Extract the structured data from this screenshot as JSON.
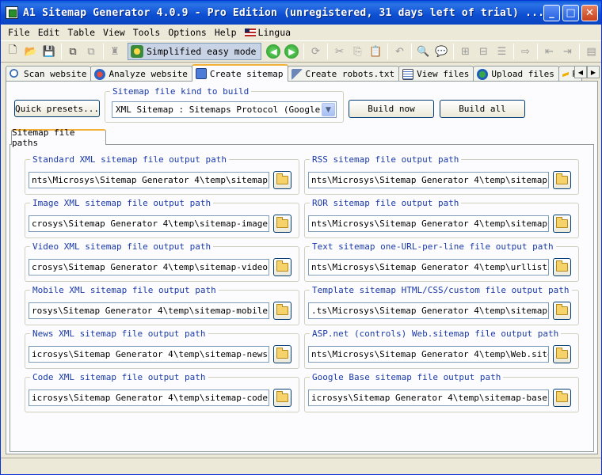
{
  "window": {
    "title": "A1 Sitemap Generator 4.0.9 - Pro Edition (unregistered, 31 days left of trial) ...",
    "min": "_",
    "max": "□",
    "close": "✕"
  },
  "menu": [
    "File",
    "Edit",
    "Table",
    "View",
    "Tools",
    "Options",
    "Help",
    "Lingua"
  ],
  "toolbar": {
    "easy_mode_label": "Simplified easy mode"
  },
  "main_tabs": [
    {
      "label": "Scan website",
      "icon": "magnifier-icon"
    },
    {
      "label": "Analyze website",
      "icon": "globe-icon"
    },
    {
      "label": "Create sitemap",
      "icon": "sitemap-icon",
      "active": true
    },
    {
      "label": "Create robots.txt",
      "icon": "filter-icon"
    },
    {
      "label": "View files",
      "icon": "document-icon"
    },
    {
      "label": "Upload files",
      "icon": "upload-icon"
    },
    {
      "label": "P",
      "icon": "bolt-icon"
    }
  ],
  "tab_arrows": {
    "left": "◀",
    "right": "▶"
  },
  "controls": {
    "quick_presets": "Quick presets...",
    "kind_group_label": "Sitemap file kind to build",
    "kind_selected": "XML Sitemap : Sitemaps Protocol (Google Sit",
    "dropdown_arrow": "▼",
    "build_now": "Build now",
    "build_all": "Build all"
  },
  "sub_tab": "Sitemap file paths",
  "paths_left": [
    {
      "label": "Standard XML sitemap file output path",
      "value": "nts\\Microsys\\Sitemap Generator 4\\temp\\sitemap.xml"
    },
    {
      "label": "Image XML sitemap file output path",
      "value": "crosys\\Sitemap Generator 4\\temp\\sitemap-image.xml"
    },
    {
      "label": "Video XML sitemap file output path",
      "value": "crosys\\Sitemap Generator 4\\temp\\sitemap-video.xml"
    },
    {
      "label": "Mobile XML sitemap file output path",
      "value": "rosys\\Sitemap Generator 4\\temp\\sitemap-mobile.xml"
    },
    {
      "label": "News XML sitemap file output path",
      "value": "icrosys\\Sitemap Generator 4\\temp\\sitemap-news.xml"
    },
    {
      "label": "Code XML sitemap file output path",
      "value": "icrosys\\Sitemap Generator 4\\temp\\sitemap-code.xml"
    }
  ],
  "paths_right": [
    {
      "label": "RSS sitemap file output path",
      "value": "nts\\Microsys\\Sitemap Generator 4\\temp\\sitemap.rss"
    },
    {
      "label": "ROR sitemap file output path",
      "value": "nts\\Microsys\\Sitemap Generator 4\\temp\\sitemap.ror"
    },
    {
      "label": "Text sitemap one-URL-per-line file output path",
      "value": "nts\\Microsys\\Sitemap Generator 4\\temp\\urllist.txt"
    },
    {
      "label": "Template sitemap HTML/CSS/custom file output path",
      "value": ".ts\\Microsys\\Sitemap Generator 4\\temp\\sitemap.html"
    },
    {
      "label": "ASP.net (controls) Web.sitemap file output path",
      "value": "nts\\Microsys\\Sitemap Generator 4\\temp\\Web.sitemap"
    },
    {
      "label": "Google Base sitemap file output path",
      "value": "icrosys\\Sitemap Generator 4\\temp\\sitemap-base.xml"
    }
  ]
}
